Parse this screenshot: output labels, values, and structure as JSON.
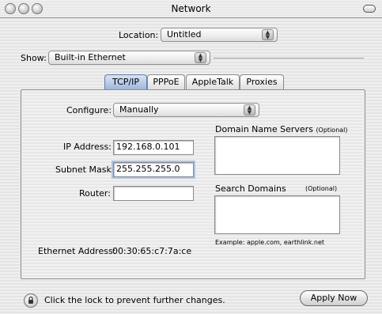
{
  "window": {
    "title": "Network"
  },
  "location": {
    "label": "Location:",
    "value": "Untitled"
  },
  "show": {
    "label": "Show:",
    "value": "Built-in Ethernet"
  },
  "tabs": [
    {
      "label": "TCP/IP",
      "active": true
    },
    {
      "label": "PPPoE",
      "active": false
    },
    {
      "label": "AppleTalk",
      "active": false
    },
    {
      "label": "Proxies",
      "active": false
    }
  ],
  "configure": {
    "label": "Configure:",
    "value": "Manually"
  },
  "ip": {
    "label": "IP Address:",
    "value": "192.168.0.101"
  },
  "subnet": {
    "label": "Subnet Mask:",
    "value": "255.255.255.0"
  },
  "router": {
    "label": "Router:",
    "value": ""
  },
  "dns": {
    "label": "Domain Name Servers",
    "optional": "(Optional)"
  },
  "search_domains": {
    "label": "Search Domains",
    "optional": "(Optional)"
  },
  "example": "Example: apple.com, earthlink.net",
  "ethernet": {
    "label": "Ethernet Address:",
    "value": "00:30:65:c7:7a:ce"
  },
  "footer": {
    "lock_text": "Click the lock to prevent further changes.",
    "apply_label": "Apply Now"
  },
  "icons": {
    "lock": "lock-icon",
    "close": "close-button-icon",
    "minimize": "minimize-button-icon",
    "zoom": "zoom-button-icon"
  }
}
